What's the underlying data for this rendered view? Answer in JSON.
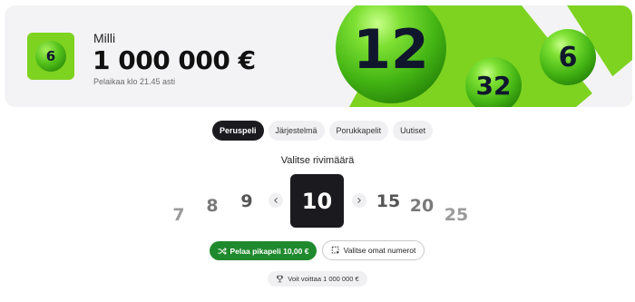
{
  "hero": {
    "logo_ball_number": "6",
    "game_name": "Milli",
    "jackpot": "1 000 000 €",
    "deadline": "Pelaikaa klo 21.45 asti",
    "balls": [
      "12",
      "32",
      "6"
    ],
    "accent_color": "#7ed321"
  },
  "tabs": [
    {
      "label": "Peruspeli",
      "active": true
    },
    {
      "label": "Järjestelmä",
      "active": false
    },
    {
      "label": "Porukkapelit",
      "active": false
    },
    {
      "label": "Uutiset",
      "active": false
    }
  ],
  "selector": {
    "title": "Valitse rivimäärä",
    "options": [
      "7",
      "8",
      "9",
      "10",
      "15",
      "20",
      "25"
    ],
    "selected": "10"
  },
  "actions": {
    "quick_play_label": "Pelaa pikapeli 10,00 €",
    "quick_play_icon": "shuffle-icon",
    "own_numbers_label": "Valitse omat numerot",
    "own_numbers_icon": "grid-select-icon",
    "primary_color": "#1f8a2d"
  },
  "win_info": {
    "label": "Voit voittaa 1 000 000 €",
    "icon": "trophy-icon"
  }
}
